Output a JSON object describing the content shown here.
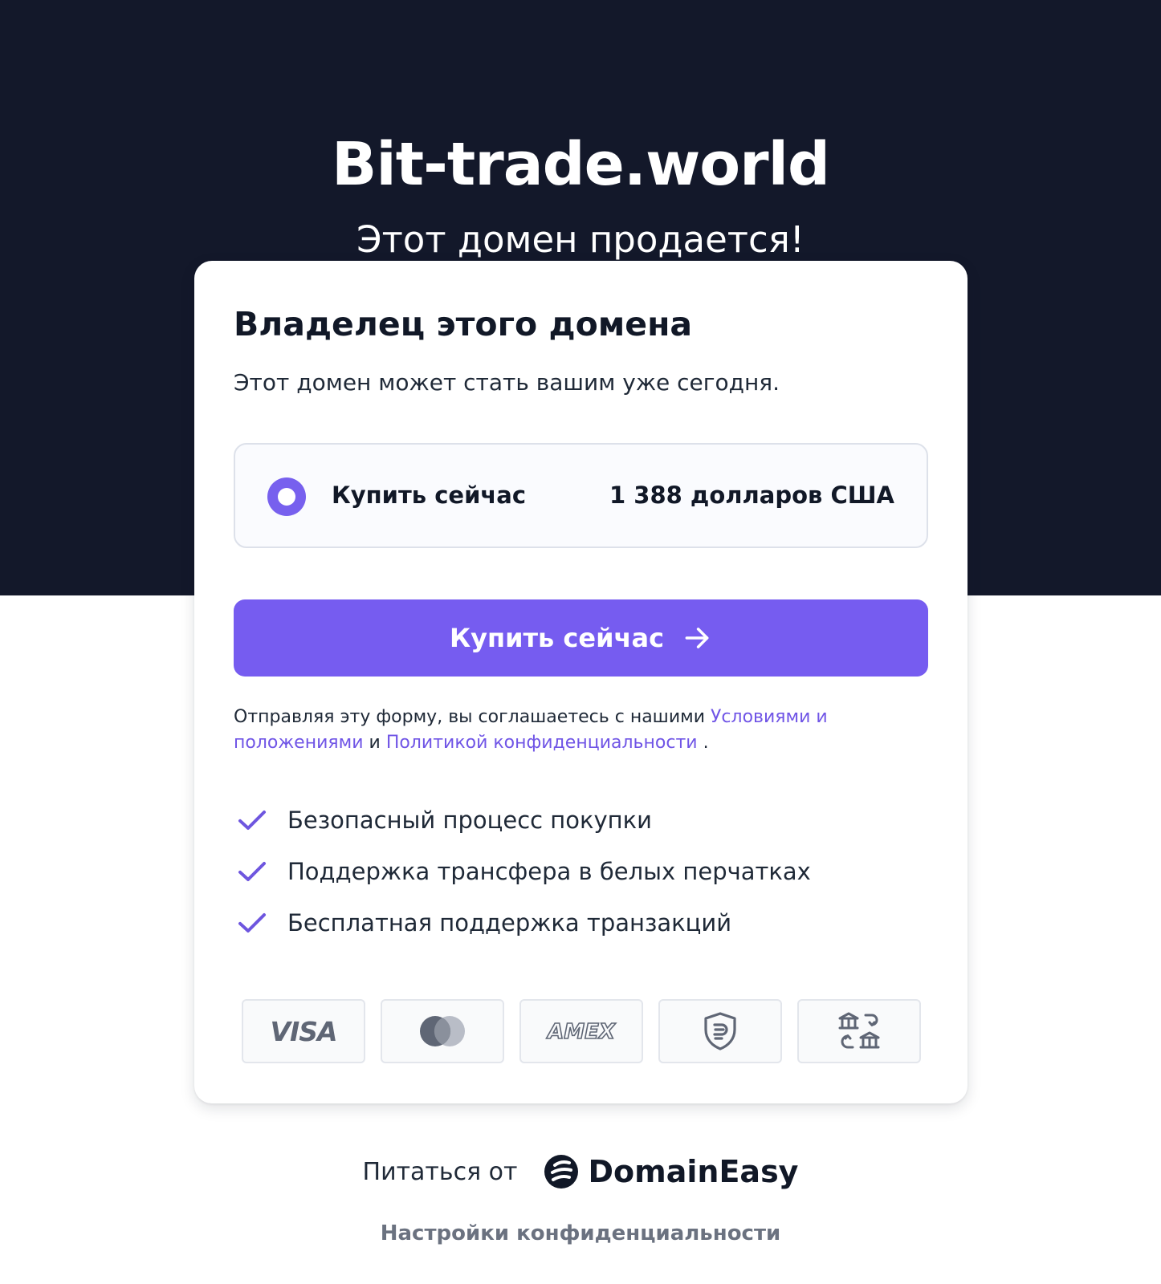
{
  "hero": {
    "domain": "Bit-trade.world",
    "for_sale": "Этот домен продается!"
  },
  "card": {
    "title": "Владелец этого домена",
    "subtitle": "Этот домен может стать вашим уже сегодня.",
    "option": {
      "label": "Купить сейчас",
      "price": "1 388 долларов США",
      "selected": true
    },
    "buy_button": {
      "label": "Купить сейчас",
      "icon": "arrow-right-icon"
    },
    "terms": {
      "prefix": "Отправляя эту форму, вы соглашаетесь с нашими",
      "terms_link": "Условиями и положениями",
      "middle": "и",
      "privacy_link": "Политикой конфиденциальности",
      "suffix": "."
    },
    "features": [
      "Безопасный процесс покупки",
      "Поддержка трансфера в белых перчатках",
      "Бесплатная поддержка транзакций"
    ],
    "payments": {
      "visa": "VISA",
      "amex": "AMEX",
      "icons": [
        "visa-icon",
        "mastercard-icon",
        "amex-icon",
        "escrow-shield-icon",
        "bank-transfer-icon"
      ]
    }
  },
  "footer": {
    "powered_by": "Питаться от",
    "brand": "DomainEasy",
    "privacy_settings": "Настройки конфиденциальности"
  },
  "colors": {
    "hero_bg": "#13182a",
    "accent": "#765cf0",
    "link": "#7055e6"
  }
}
